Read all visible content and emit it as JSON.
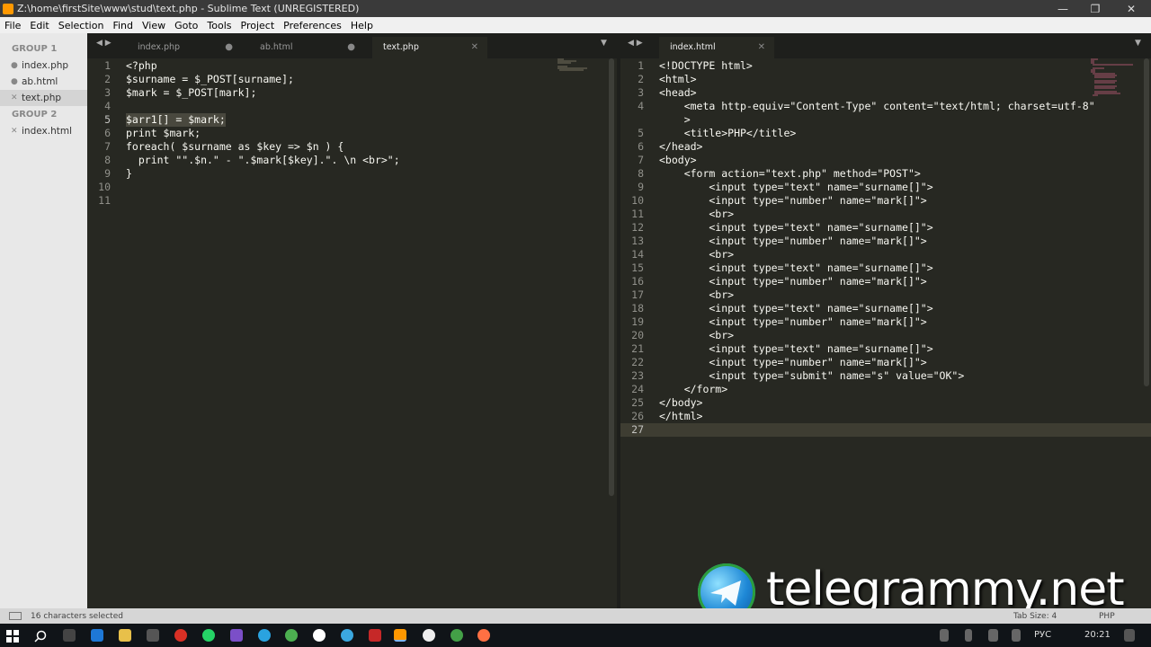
{
  "window": {
    "title": "Z:\\home\\firstSite\\www\\stud\\text.php - Sublime Text (UNREGISTERED)",
    "minimize": "—",
    "restore": "❐",
    "close": "✕"
  },
  "menu": [
    "File",
    "Edit",
    "Selection",
    "Find",
    "View",
    "Goto",
    "Tools",
    "Project",
    "Preferences",
    "Help"
  ],
  "sidebar": {
    "group1": "GROUP 1",
    "group1_items": [
      {
        "label": "index.php",
        "marker": "●"
      },
      {
        "label": "ab.html",
        "marker": "●"
      },
      {
        "label": "text.php",
        "marker": "✕"
      }
    ],
    "group2": "GROUP 2",
    "group2_items": [
      {
        "label": "index.html",
        "marker": "✕"
      }
    ]
  },
  "left_tabs": [
    {
      "label": "index.php",
      "close": "●"
    },
    {
      "label": "ab.html",
      "close": "●"
    },
    {
      "label": "text.php",
      "close": "✕"
    }
  ],
  "right_tabs": [
    {
      "label": "index.html",
      "close": "✕"
    }
  ],
  "nav": {
    "arrows": "◀ ▶",
    "dropdown": "▼"
  },
  "left_code": {
    "numbers": [
      "1",
      "2",
      "3",
      "4",
      "5",
      "6",
      "7",
      "8",
      "9",
      "10",
      "11"
    ],
    "lines": [
      "<?php",
      "$surname = $_POST[surname];",
      "$mark = $_POST[mark];",
      "",
      "$arr1[] = $mark;",
      "print $mark;",
      "foreach( $surname as $key => $n ) {",
      "  print \"\".$n.\" - \".$mark[$key].\". \\n <br>\";",
      "}",
      "",
      ""
    ]
  },
  "right_code": {
    "numbers": [
      "1",
      "2",
      "3",
      "4",
      "",
      "5",
      "6",
      "7",
      "8",
      "9",
      "10",
      "11",
      "12",
      "13",
      "14",
      "15",
      "16",
      "17",
      "18",
      "19",
      "20",
      "21",
      "22",
      "23",
      "24",
      "25",
      "26",
      "27"
    ],
    "lines": [
      "<!DOCTYPE html>",
      "<html>",
      "<head>",
      "    <meta http-equiv=\"Content-Type\" content=\"text/html; charset=utf-8\"",
      "    >",
      "    <title>PHP</title>",
      "</head>",
      "<body>",
      "    <form action=\"text.php\" method=\"POST\">",
      "        <input type=\"text\" name=\"surname[]\">",
      "        <input type=\"number\" name=\"mark[]\">",
      "        <br>",
      "        <input type=\"text\" name=\"surname[]\">",
      "        <input type=\"number\" name=\"mark[]\">",
      "        <br>",
      "        <input type=\"text\" name=\"surname[]\">",
      "        <input type=\"number\" name=\"mark[]\">",
      "        <br>",
      "        <input type=\"text\" name=\"surname[]\">",
      "        <input type=\"number\" name=\"mark[]\">",
      "        <br>",
      "        <input type=\"text\" name=\"surname[]\">",
      "        <input type=\"number\" name=\"mark[]\">",
      "        <input type=\"submit\" name=\"s\" value=\"OK\">",
      "    </form>",
      "</body>",
      "</html>",
      ""
    ]
  },
  "status": {
    "selection": "16 characters selected",
    "tab_size": "Tab Size: 4",
    "syntax": "PHP"
  },
  "taskbar": {
    "lang": "РУС",
    "time": "20:21"
  },
  "watermark": "telegrammy.net"
}
